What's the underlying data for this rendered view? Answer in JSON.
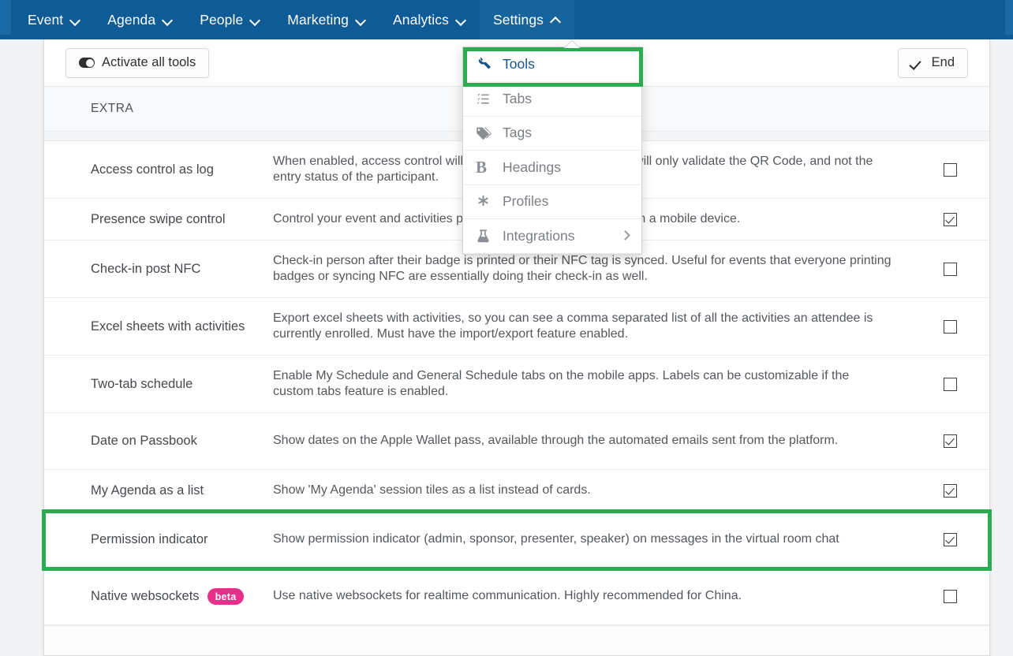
{
  "topnav": {
    "items": [
      {
        "label": "Event",
        "icon": "chevron-down-icon",
        "active": false
      },
      {
        "label": "Agenda",
        "icon": "chevron-down-icon",
        "active": false
      },
      {
        "label": "People",
        "icon": "chevron-down-icon",
        "active": false
      },
      {
        "label": "Marketing",
        "icon": "chevron-down-icon",
        "active": false
      },
      {
        "label": "Analytics",
        "icon": "chevron-down-icon",
        "active": false
      },
      {
        "label": "Settings",
        "icon": "chevron-up-icon",
        "active": true
      }
    ]
  },
  "dropdown": {
    "items": [
      {
        "label": "Tools",
        "icon": "wrench-icon",
        "selected": true,
        "submenu": false
      },
      {
        "label": "Tabs",
        "icon": "list-check-icon",
        "selected": false,
        "submenu": false
      },
      {
        "label": "Tags",
        "icon": "tags-icon",
        "selected": false,
        "submenu": false
      },
      {
        "label": "Headings",
        "icon": "bold-b-icon",
        "selected": false,
        "submenu": false
      },
      {
        "label": "Profiles",
        "icon": "asterisk-icon",
        "selected": false,
        "submenu": false
      },
      {
        "label": "Integrations",
        "icon": "flask-icon",
        "selected": false,
        "submenu": true
      }
    ],
    "highlight_color": "#2bac4e",
    "selected_color": "#15558c"
  },
  "toolbar": {
    "activate_all_label": "Activate all tools",
    "activate_all_icon": "toggle-icon",
    "end_label": "End",
    "end_icon": "check-icon"
  },
  "section": {
    "title": "EXTRA"
  },
  "table": {
    "rows": [
      {
        "name": "Access control as log",
        "description": "When enabled, access control will work as a log, meaning that it will only validate the QR Code, and not the entry status of the participant.",
        "checked": false,
        "height": "tall",
        "badge": null
      },
      {
        "name": "Presence swipe control",
        "description": "Control your event and activities presence with a swipe function on a mobile device.",
        "checked": true,
        "height": "normal",
        "badge": null
      },
      {
        "name": "Check-in post NFC",
        "description": "Check-in person after their badge is printed or their NFC tag is synced. Useful for events that everyone printing badges or syncing NFC are essentially doing their check-in as well.",
        "checked": false,
        "height": "tall",
        "badge": null
      },
      {
        "name": "Excel sheets with activities",
        "description": "Export excel sheets with activities, so you can see a comma separated list of all the activities an attendee is currently enrolled. Must have the import/export feature enabled.",
        "checked": false,
        "height": "tall",
        "badge": null
      },
      {
        "name": "Two-tab schedule",
        "description": "Enable My Schedule and General Schedule tabs on the mobile apps. Labels can be customizable if the custom tabs feature is enabled.",
        "checked": false,
        "height": "tall",
        "badge": null
      },
      {
        "name": "Date on Passbook",
        "description": "Show dates on the Apple Wallet pass, available through the automated emails sent from the platform.",
        "checked": true,
        "height": "normal",
        "badge": null
      },
      {
        "name": "My Agenda as a list",
        "description": "Show 'My Agenda' session tiles as a list instead of cards.",
        "checked": true,
        "height": "normal",
        "badge": null
      },
      {
        "name": "Permission indicator",
        "description": "Show permission indicator (admin, sponsor, presenter, speaker) on messages in the virtual room chat",
        "checked": true,
        "height": "normal",
        "badge": null,
        "highlighted": true
      },
      {
        "name": "Native websockets",
        "description": "Use native websockets for realtime communication. Highly recommended for China.",
        "checked": false,
        "height": "normal",
        "badge": "beta"
      }
    ]
  },
  "colors": {
    "nav_background": "#0f5b96",
    "nav_active": "#17649d",
    "highlight_green": "#2bac4e",
    "beta_badge": "#e8308a",
    "link_blue": "#15558c"
  }
}
